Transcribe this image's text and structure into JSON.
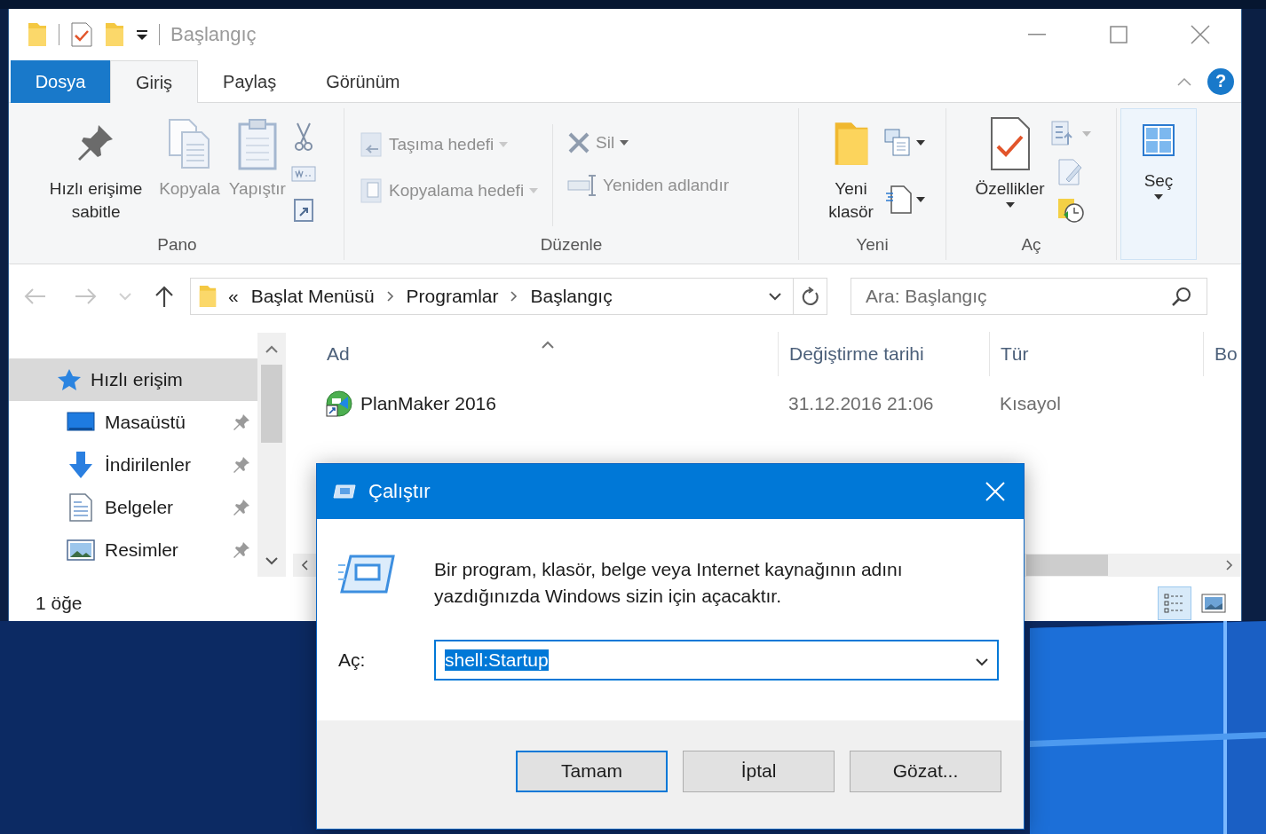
{
  "explorer": {
    "title": "Başlangıç",
    "help_button": "?",
    "ribbon_tabs": [
      {
        "label": "Dosya",
        "kind": "file",
        "selected": false
      },
      {
        "label": "Giriş",
        "kind": "tab",
        "selected": true
      },
      {
        "label": "Paylaş",
        "kind": "tab",
        "selected": false
      },
      {
        "label": "Görünüm",
        "kind": "tab",
        "selected": false
      }
    ],
    "ribbon_groups": [
      {
        "label": "Pano",
        "commands": [
          {
            "label": "Hızlı erişime sabitle",
            "kind": "large",
            "disabled": false
          },
          {
            "label": "Kopyala",
            "kind": "large",
            "disabled": true
          },
          {
            "label": "Yapıştır",
            "kind": "large",
            "disabled": true
          }
        ]
      },
      {
        "label": "Düzenle",
        "commands": [
          {
            "label": "Taşıma hedefi",
            "kind": "small",
            "disabled": true
          },
          {
            "label": "Kopyalama hedefi",
            "kind": "small",
            "disabled": true
          },
          {
            "label": "Sil",
            "kind": "small",
            "disabled": true
          },
          {
            "label": "Yeniden adlandır",
            "kind": "small",
            "disabled": true
          }
        ]
      },
      {
        "label": "Yeni",
        "commands": [
          {
            "label": "Yeni klasör",
            "kind": "large",
            "disabled": false
          }
        ]
      },
      {
        "label": "Aç",
        "commands": [
          {
            "label": "Özellikler",
            "kind": "large",
            "disabled": false
          }
        ]
      },
      {
        "commands": [
          {
            "label": "Seç",
            "kind": "large",
            "disabled": false
          }
        ]
      }
    ],
    "address": {
      "overflow": "«",
      "crumbs": [
        "Başlat Menüsü",
        "Programlar",
        "Başlangıç"
      ]
    },
    "search": {
      "placeholder": "Ara: Başlangıç"
    },
    "navigation": [
      {
        "label": "Hızlı erişim",
        "selected": true,
        "children": [
          {
            "label": "Masaüstü",
            "pinned": true,
            "selected": false
          },
          {
            "label": "İndirilenler",
            "pinned": true,
            "selected": false
          },
          {
            "label": "Belgeler",
            "pinned": true,
            "selected": false
          },
          {
            "label": "Resimler",
            "pinned": true,
            "selected": false
          }
        ]
      }
    ],
    "columns": [
      "Ad",
      "Değiştirme tarihi",
      "Tür",
      "Bo"
    ],
    "rows": [
      {
        "name": "PlanMaker 2016",
        "modified": "31.12.2016 21:06",
        "type": "Kısayol"
      }
    ],
    "status_bar": {
      "item_count": "1 öğe",
      "views": [
        {
          "kind": "details",
          "selected": true
        },
        {
          "kind": "large-icons",
          "selected": false
        }
      ]
    }
  },
  "run_dialog": {
    "title": "Çalıştır",
    "description": "Bir program, klasör, belge veya Internet kaynağının adını yazdığınızda Windows sizin için açacaktır.",
    "open_label": "Aç:",
    "open_value": "shell:Startup",
    "value_selected": true,
    "buttons": [
      {
        "label": "Tamam",
        "default": true
      },
      {
        "label": "İptal",
        "default": false
      },
      {
        "label": "Gözat...",
        "default": false
      }
    ]
  }
}
